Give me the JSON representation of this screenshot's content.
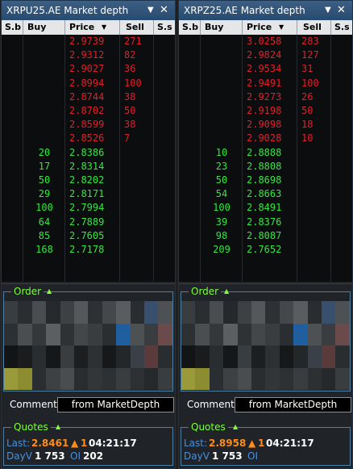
{
  "panels": [
    {
      "title": "XRPU25.AE Market depth",
      "headers": {
        "sb": "S.b",
        "buy": "Buy",
        "price": "Price",
        "sell": "Sell",
        "ss": "S.s"
      },
      "asks": [
        {
          "price": "2.9739",
          "sell": "271"
        },
        {
          "price": "2.9312",
          "sell": "82"
        },
        {
          "price": "2.9027",
          "sell": "36"
        },
        {
          "price": "2.8994",
          "sell": "100"
        },
        {
          "price": "2.8744",
          "sell": "38"
        },
        {
          "price": "2.8702",
          "sell": "50"
        },
        {
          "price": "2.8599",
          "sell": "38"
        },
        {
          "price": "2.8526",
          "sell": "7"
        }
      ],
      "bids": [
        {
          "buy": "20",
          "price": "2.8386"
        },
        {
          "buy": "17",
          "price": "2.8314"
        },
        {
          "buy": "50",
          "price": "2.8202"
        },
        {
          "buy": "29",
          "price": "2.8171"
        },
        {
          "buy": "100",
          "price": "2.7994"
        },
        {
          "buy": "64",
          "price": "2.7889"
        },
        {
          "buy": "85",
          "price": "2.7605"
        },
        {
          "buy": "168",
          "price": "2.7178"
        }
      ],
      "order_title": "Order",
      "comment_label": "Comment:",
      "comment_value": "from MarketDepth",
      "quotes_title": "Quotes",
      "quotes": {
        "last_label": "Last:",
        "last_value": "2.8461",
        "arrow": "▲",
        "last_qty": "1",
        "time": "04:21:17",
        "dayv_label": "DayV",
        "dayv_value": "1 753",
        "oi_label": "OI",
        "oi_value": "202"
      }
    },
    {
      "title": "XRPZ25.AE Market depth",
      "headers": {
        "sb": "S.b",
        "buy": "Buy",
        "price": "Price",
        "sell": "Sell",
        "ss": "S.s"
      },
      "asks": [
        {
          "price": "3.0258",
          "sell": "283"
        },
        {
          "price": "2.9824",
          "sell": "127"
        },
        {
          "price": "2.9534",
          "sell": "31"
        },
        {
          "price": "2.9491",
          "sell": "100"
        },
        {
          "price": "2.9273",
          "sell": "26"
        },
        {
          "price": "2.9198",
          "sell": "50"
        },
        {
          "price": "2.9098",
          "sell": "18"
        },
        {
          "price": "2.9028",
          "sell": "10"
        }
      ],
      "bids": [
        {
          "buy": "10",
          "price": "2.8888"
        },
        {
          "buy": "23",
          "price": "2.8808"
        },
        {
          "buy": "50",
          "price": "2.8698"
        },
        {
          "buy": "54",
          "price": "2.8663"
        },
        {
          "buy": "100",
          "price": "2.8491"
        },
        {
          "buy": "39",
          "price": "2.8376"
        },
        {
          "buy": "98",
          "price": "2.8087"
        },
        {
          "buy": "209",
          "price": "2.7652"
        }
      ],
      "order_title": "Order",
      "comment_label": "Comment:",
      "comment_value": "from MarketDepth",
      "quotes_title": "Quotes",
      "quotes": {
        "last_label": "Last:",
        "last_value": "2.8958",
        "arrow": "▲",
        "last_qty": "1",
        "time": "04:21:17",
        "dayv_label": "DayV",
        "dayv_value": "1 753",
        "oi_label": "OI",
        "oi_value": ""
      }
    }
  ],
  "window_icons": {
    "pin": "pin-icon",
    "close": "close-icon",
    "sort": "sort-down-icon",
    "collapse": "collapse-up-icon"
  },
  "colors": {
    "ask": "#e0202a",
    "bid": "#33e83f",
    "header_bg": "#e4e6e8",
    "title_bg": "#2d5079",
    "section_label": "#7dff3a",
    "last_value": "#ff8c1a",
    "label_blue": "#4a90d9"
  }
}
